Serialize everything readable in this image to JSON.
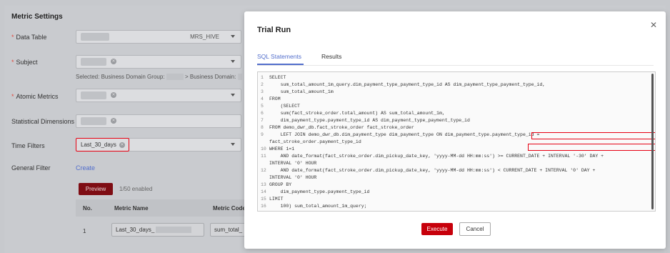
{
  "settings": {
    "title": "Metric Settings",
    "rows": [
      {
        "label": "Data Table",
        "required": true
      },
      {
        "label": "Subject",
        "required": true
      },
      {
        "label": "Atomic Metrics",
        "required": true
      },
      {
        "label": "Statistical Dimensions",
        "required": false
      },
      {
        "label": "Time Filters",
        "required": false
      },
      {
        "label": "General Filter",
        "required": false
      }
    ],
    "data_table_source": "MRS_HIVE",
    "selected_prefix": "Selected: Business Domain Group:",
    "selected_mid": "> Business Domain:",
    "time_filter_value": "Last_30_days",
    "create_link": "Create",
    "preview_label": "Preview",
    "enabled_text": "1/50 enabled",
    "table": {
      "headers": [
        "No.",
        "Metric Name",
        "Metric Code"
      ],
      "row": {
        "no": "1",
        "name": "Last_30_days_",
        "code": "sum_total_"
      }
    }
  },
  "modal": {
    "title": "Trial Run",
    "close_icon": "close-icon",
    "tabs": [
      "SQL Statements",
      "Results"
    ],
    "code_lines": [
      {
        "n": "1",
        "text": "SELECT"
      },
      {
        "n": "2",
        "text": "    sum_total_amount_1m_query.dim_payment_type_payment_type_id AS dim_payment_type_payment_type_id,"
      },
      {
        "n": "3",
        "text": "    sum_total_amount_1m"
      },
      {
        "n": "4",
        "text": "FROM"
      },
      {
        "n": "5",
        "text": "    (SELECT"
      },
      {
        "n": "6",
        "text": "    sum(fact_stroke_order.total_amount) AS sum_total_amount_1m,"
      },
      {
        "n": "7",
        "text": "    dim_payment_type.payment_type_id AS dim_payment_type_payment_type_id"
      },
      {
        "n": "8",
        "text": "FROM demo_dwr_db.fact_stroke_order fact_stroke_order"
      },
      {
        "n": "9",
        "text": "    LEFT JOIN demo_dwr_db.dim_payment_type dim_payment_type ON dim_payment_type.payment_type_id ="
      },
      {
        "n": "",
        "text": "fact_stroke_order.payment_type_id"
      },
      {
        "n": "10",
        "text": "WHERE 1=1"
      },
      {
        "n": "11",
        "text": "    AND date_format(fact_stroke_order.dim_pickup_date_key, 'yyyy-MM-dd HH:mm:ss') >= CURRENT_DATE + INTERVAL '-30' DAY +"
      },
      {
        "n": "",
        "text": "INTERVAL '0' HOUR"
      },
      {
        "n": "12",
        "text": "    AND date_format(fact_stroke_order.dim_pickup_date_key, 'yyyy-MM-dd HH:mm:ss') < CURRENT_DATE + INTERVAL '0' DAY +"
      },
      {
        "n": "",
        "text": "INTERVAL '0' HOUR"
      },
      {
        "n": "13",
        "text": "GROUP BY"
      },
      {
        "n": "14",
        "text": "    dim_payment_type.payment_type_id"
      },
      {
        "n": "15",
        "text": "LIMIT"
      },
      {
        "n": "16",
        "text": "    100) sum_total_amount_1m_query;"
      }
    ],
    "execute_label": "Execute",
    "cancel_label": "Cancel"
  },
  "colors": {
    "accent": "#526ecc",
    "primary_button": "#c7000b",
    "highlight": "#e60012"
  }
}
